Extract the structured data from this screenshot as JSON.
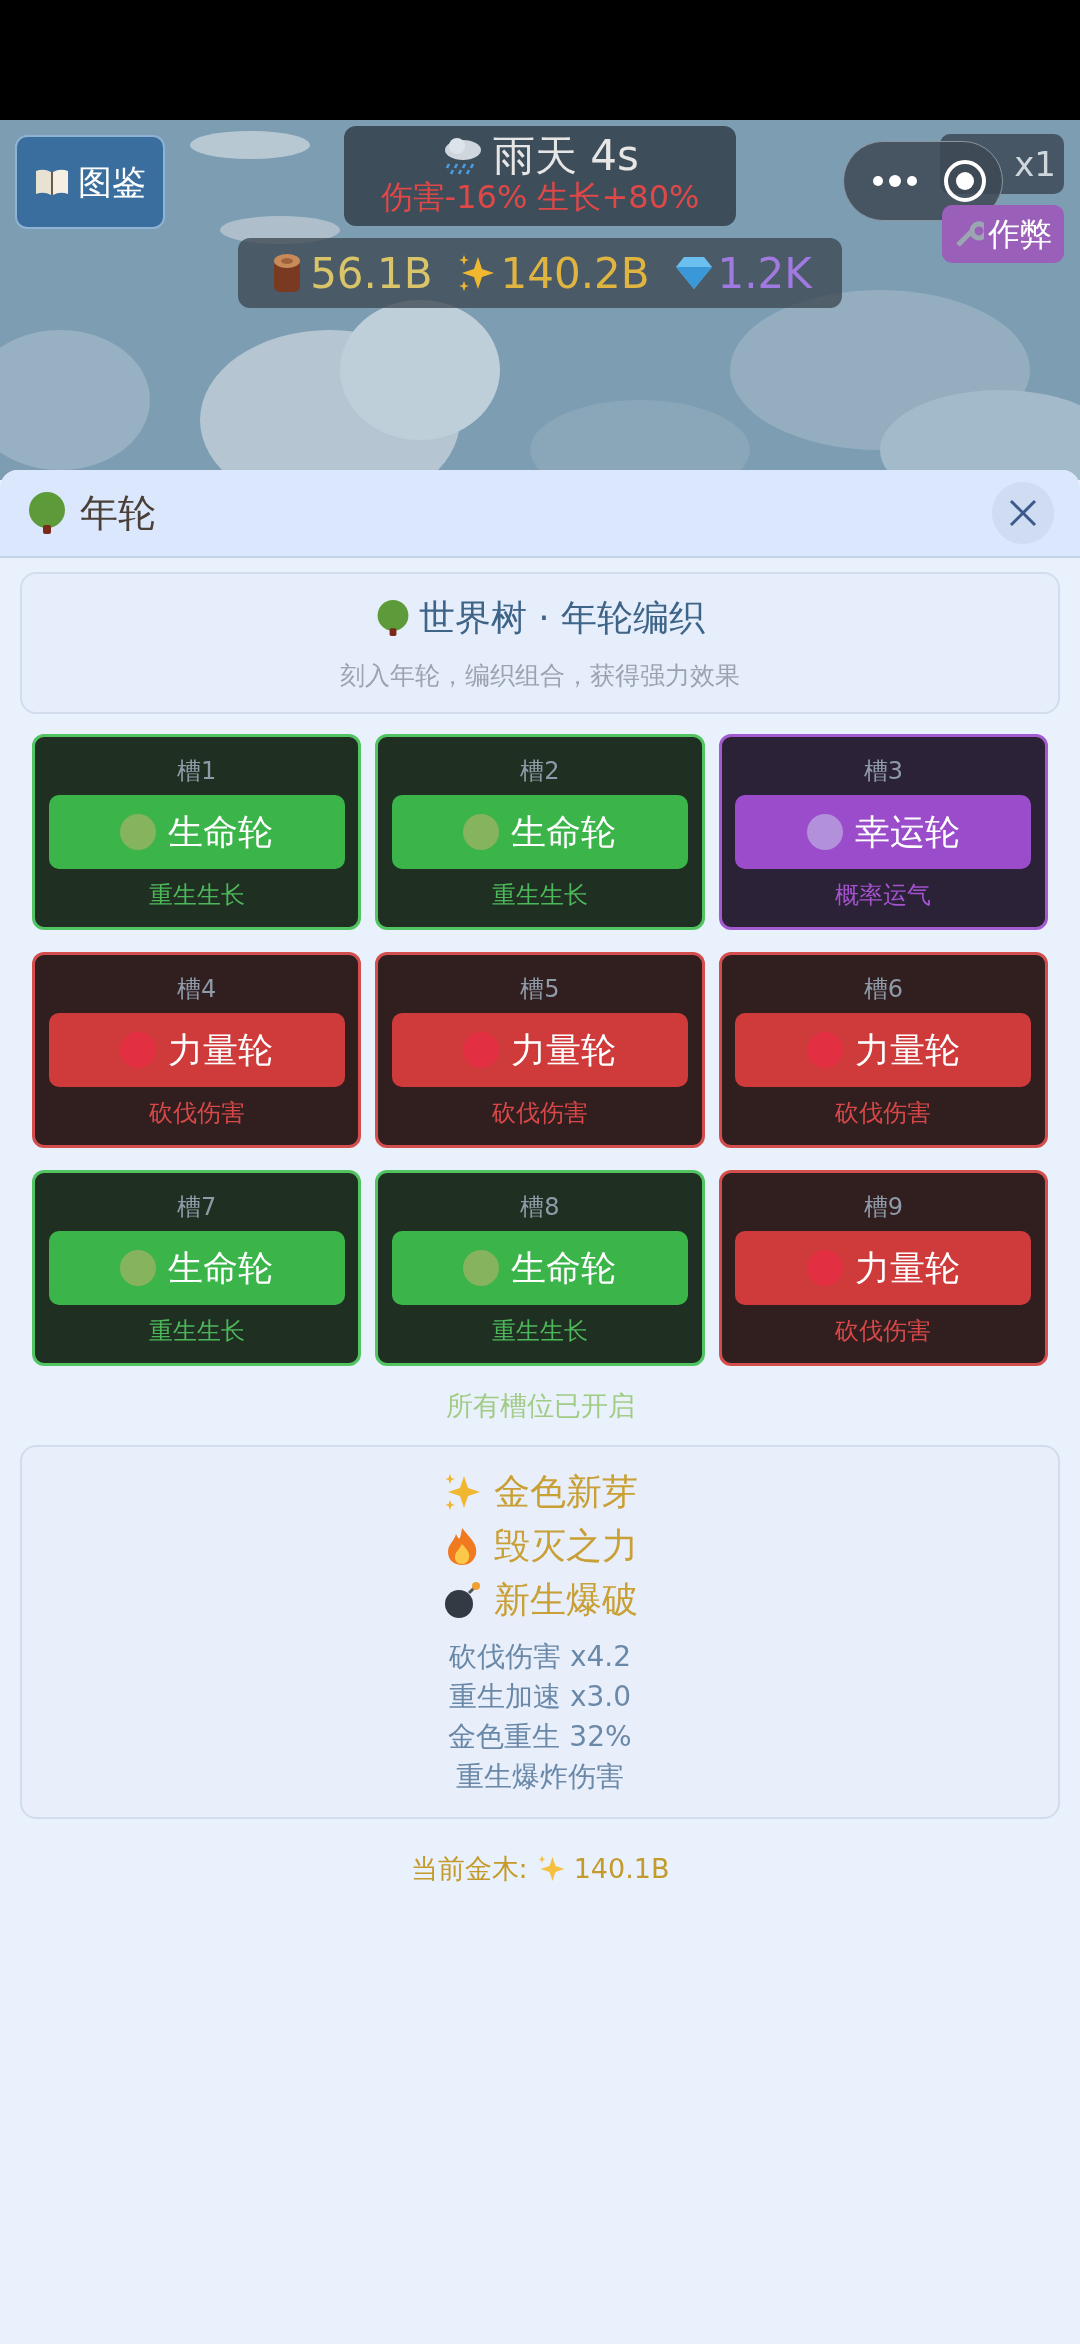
{
  "top_bar": {
    "guide_button": "图鉴",
    "weather": {
      "label": "雨天 4s",
      "effects": "伤害-16% 生长+80%"
    },
    "resources": [
      {
        "kind": "wood",
        "value": "56.1B"
      },
      {
        "kind": "gold",
        "value": "140.2B"
      },
      {
        "kind": "gem",
        "value": "1.2K"
      }
    ],
    "speed_button": "x1",
    "cheat_button": "作弊"
  },
  "sheet": {
    "title": "年轮",
    "intro": {
      "title": "世界树 · 年轮编织",
      "subtitle": "刻入年轮，编织组合，获得强力效果"
    },
    "slots": [
      {
        "label": "槽1",
        "ring": "生命轮",
        "effect": "重生生长",
        "kind": "life"
      },
      {
        "label": "槽2",
        "ring": "生命轮",
        "effect": "重生生长",
        "kind": "life"
      },
      {
        "label": "槽3",
        "ring": "幸运轮",
        "effect": "概率运气",
        "kind": "luck"
      },
      {
        "label": "槽4",
        "ring": "力量轮",
        "effect": "砍伐伤害",
        "kind": "power"
      },
      {
        "label": "槽5",
        "ring": "力量轮",
        "effect": "砍伐伤害",
        "kind": "power"
      },
      {
        "label": "槽6",
        "ring": "力量轮",
        "effect": "砍伐伤害",
        "kind": "power"
      },
      {
        "label": "槽7",
        "ring": "生命轮",
        "effect": "重生生长",
        "kind": "life"
      },
      {
        "label": "槽8",
        "ring": "生命轮",
        "effect": "重生生长",
        "kind": "life"
      },
      {
        "label": "槽9",
        "ring": "力量轮",
        "effect": "砍伐伤害",
        "kind": "power"
      }
    ],
    "status": "所有槽位已开启",
    "combos": [
      {
        "kind": "sparkle",
        "name": "金色新芽"
      },
      {
        "kind": "fire",
        "name": "毁灭之力"
      },
      {
        "kind": "bomb",
        "name": "新生爆破"
      }
    ],
    "bonuses": [
      "砍伐伤害 x4.2",
      "重生加速 x3.0",
      "金色重生 32%",
      "重生爆炸伤害"
    ],
    "current_gold": {
      "label": "当前金木:",
      "value": "140.1B"
    }
  }
}
